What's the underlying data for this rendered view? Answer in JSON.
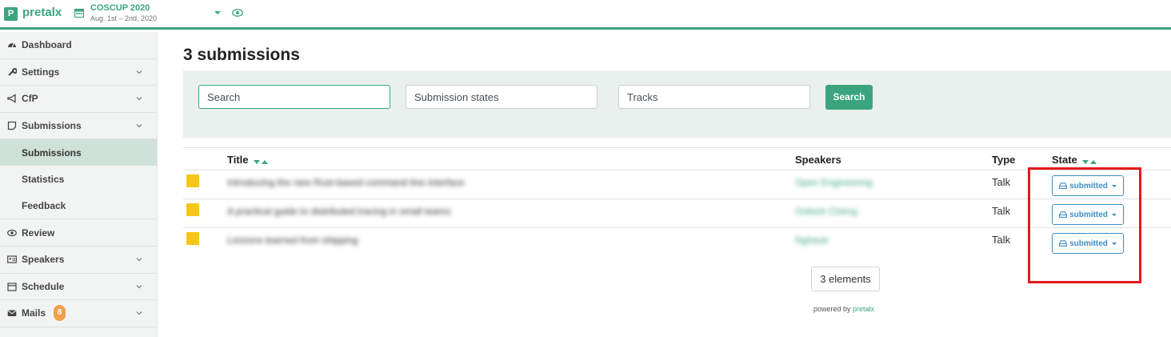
{
  "app": {
    "logo_letter": "P",
    "name": "pretalx"
  },
  "event": {
    "name": "COSCUP 2020",
    "dates": "Aug. 1st – 2nd, 2020"
  },
  "sidebar": {
    "items": [
      {
        "label": "Dashboard",
        "icon": "dashboard-icon"
      },
      {
        "label": "Settings",
        "icon": "wrench-icon",
        "chevron": true
      },
      {
        "label": "CfP",
        "icon": "bullhorn-icon",
        "chevron": true
      },
      {
        "label": "Submissions",
        "icon": "sticky-note-icon",
        "chevron": true
      }
    ],
    "sub_items": [
      "Submissions",
      "Statistics",
      "Feedback"
    ],
    "items_after": [
      {
        "label": "Review",
        "icon": "eye-icon"
      },
      {
        "label": "Speakers",
        "icon": "id-card-icon",
        "chevron": true
      },
      {
        "label": "Schedule",
        "icon": "calendar-icon",
        "chevron": true
      },
      {
        "label": "Mails",
        "icon": "envelope-icon",
        "chevron": true,
        "badge": "8"
      }
    ]
  },
  "main": {
    "title": "3 submissions",
    "filters": {
      "search_placeholder": "Search",
      "states_placeholder": "Submission states",
      "tracks_placeholder": "Tracks",
      "search_button": "Search"
    },
    "table": {
      "columns": {
        "title": "Title",
        "speakers": "Speakers",
        "type": "Type",
        "state": "State"
      },
      "rows": [
        {
          "title": "Introducing the new Rust-based command line interface",
          "speaker": "Open Engineering",
          "type": "Talk",
          "state": "submitted",
          "color": "#f5c518"
        },
        {
          "title": "A practical guide to distributed tracing in small teams",
          "speaker": "Ovberk Cheng",
          "type": "Talk",
          "state": "submitted",
          "color": "#f5c518"
        },
        {
          "title": "Lessons learned from shipping",
          "speaker": "Nghaulr",
          "type": "Talk",
          "state": "submitted",
          "color": "#f5c518"
        }
      ]
    },
    "count_label": "3 elements",
    "powered_prefix": "powered by",
    "powered_link": "pretalx"
  },
  "colors": {
    "accent": "#3aa57c",
    "state": "#3d8fc4",
    "swatch": "#f5c518",
    "badge": "#f0a04b",
    "annotation": "#e3191c"
  }
}
